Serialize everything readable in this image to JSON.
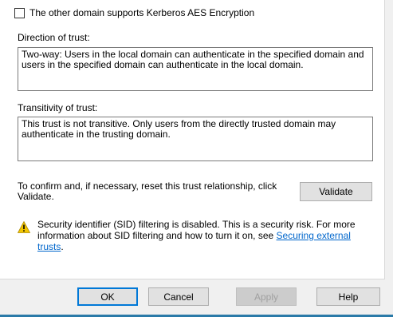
{
  "kerberos": {
    "label": "The other domain supports Kerberos AES Encryption",
    "checked": false
  },
  "direction": {
    "label": "Direction of trust:",
    "text": "Two-way: Users in the local domain can authenticate in the specified domain and users in the specified domain can authenticate in the local domain."
  },
  "transitivity": {
    "label": "Transitivity of trust:",
    "text": "This trust is not transitive. Only users from the directly trusted domain may authenticate in the trusting domain."
  },
  "validate": {
    "text": "To confirm and, if necessary, reset this trust relationship, click Validate.",
    "button": "Validate"
  },
  "warning": {
    "icon": "warning-icon",
    "text": "Security identifier (SID) filtering is disabled. This is a security risk. For more information about SID filtering and how to turn it on, see ",
    "link": "Securing external trusts",
    "suffix": "."
  },
  "buttons": {
    "ok": "OK",
    "cancel": "Cancel",
    "apply": "Apply",
    "help": "Help"
  },
  "colors": {
    "link": "#0066cc",
    "primary_border": "#0078d7",
    "warning": "#f2c500"
  }
}
